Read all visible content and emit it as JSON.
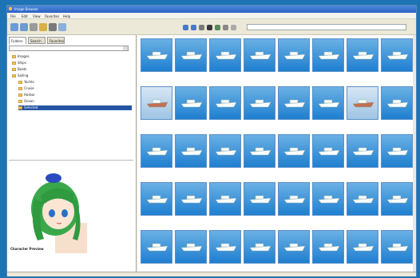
{
  "window": {
    "title": "Image Browser"
  },
  "menu": [
    "File",
    "Edit",
    "View",
    "Favorites",
    "Help"
  ],
  "toolbar": {
    "address": ""
  },
  "left": {
    "tabs": [
      "Folders",
      "Search",
      "Favorites"
    ],
    "combo": "",
    "tree": [
      {
        "label": "Images",
        "level": 1
      },
      {
        "label": "Ships",
        "level": 1
      },
      {
        "label": "Boats",
        "level": 1
      },
      {
        "label": "Sailing",
        "level": 1
      },
      {
        "label": "Yachts",
        "level": 2
      },
      {
        "label": "Cruise",
        "level": 2
      },
      {
        "label": "Harbor",
        "level": 2
      },
      {
        "label": "Ocean",
        "level": 2
      },
      {
        "label": "Selected",
        "level": 2
      }
    ],
    "preview": {
      "caption": "Character Preview",
      "info": ""
    }
  },
  "thumbs": [
    "",
    "",
    "",
    "",
    "",
    "",
    "",
    "",
    "",
    "",
    "",
    "",
    "",
    "",
    "",
    "",
    "",
    "",
    "",
    "",
    "",
    "",
    "",
    "",
    "",
    "",
    "",
    "",
    "",
    "",
    "",
    "",
    "",
    "",
    "",
    "",
    "",
    "",
    "",
    ""
  ],
  "status": {
    "left": "",
    "right": ""
  },
  "colors": {
    "desktop": "#1c74b4",
    "thumb_sky": "#1f7fd0",
    "selection": "#2454a4"
  }
}
